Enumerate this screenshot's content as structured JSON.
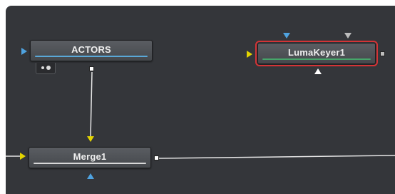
{
  "nodes": {
    "actors": {
      "label": "ACTORS"
    },
    "luma_keyer": {
      "label": "LumaKeyer1"
    },
    "merge": {
      "label": "Merge1"
    }
  },
  "colors": {
    "background": "#34363a",
    "node_fill": "#505358",
    "actors_bar": "#5aa8d8",
    "luma_bar": "#46a66a",
    "merge_bar": "#d8d8d8",
    "input_blue": "#4fa3e0",
    "input_yellow": "#e3d400",
    "input_gray": "#bdbdbd",
    "selected_outline": "#d43436",
    "wire": "#e6e6e6"
  },
  "icons": {
    "actors_input": "blue-input-triangle",
    "actors_output": "output-square",
    "luma_background_input": "yellow-input-triangle",
    "luma_mask_input": "blue-input-triangle",
    "luma_garbage_input": "gray-input-triangle",
    "luma_output": "output-square",
    "merge_background_input": "yellow-input-triangle",
    "merge_foreground_input": "yellow-input-triangle",
    "merge_mask_input": "blue-input-triangle",
    "merge_output": "output-square"
  }
}
